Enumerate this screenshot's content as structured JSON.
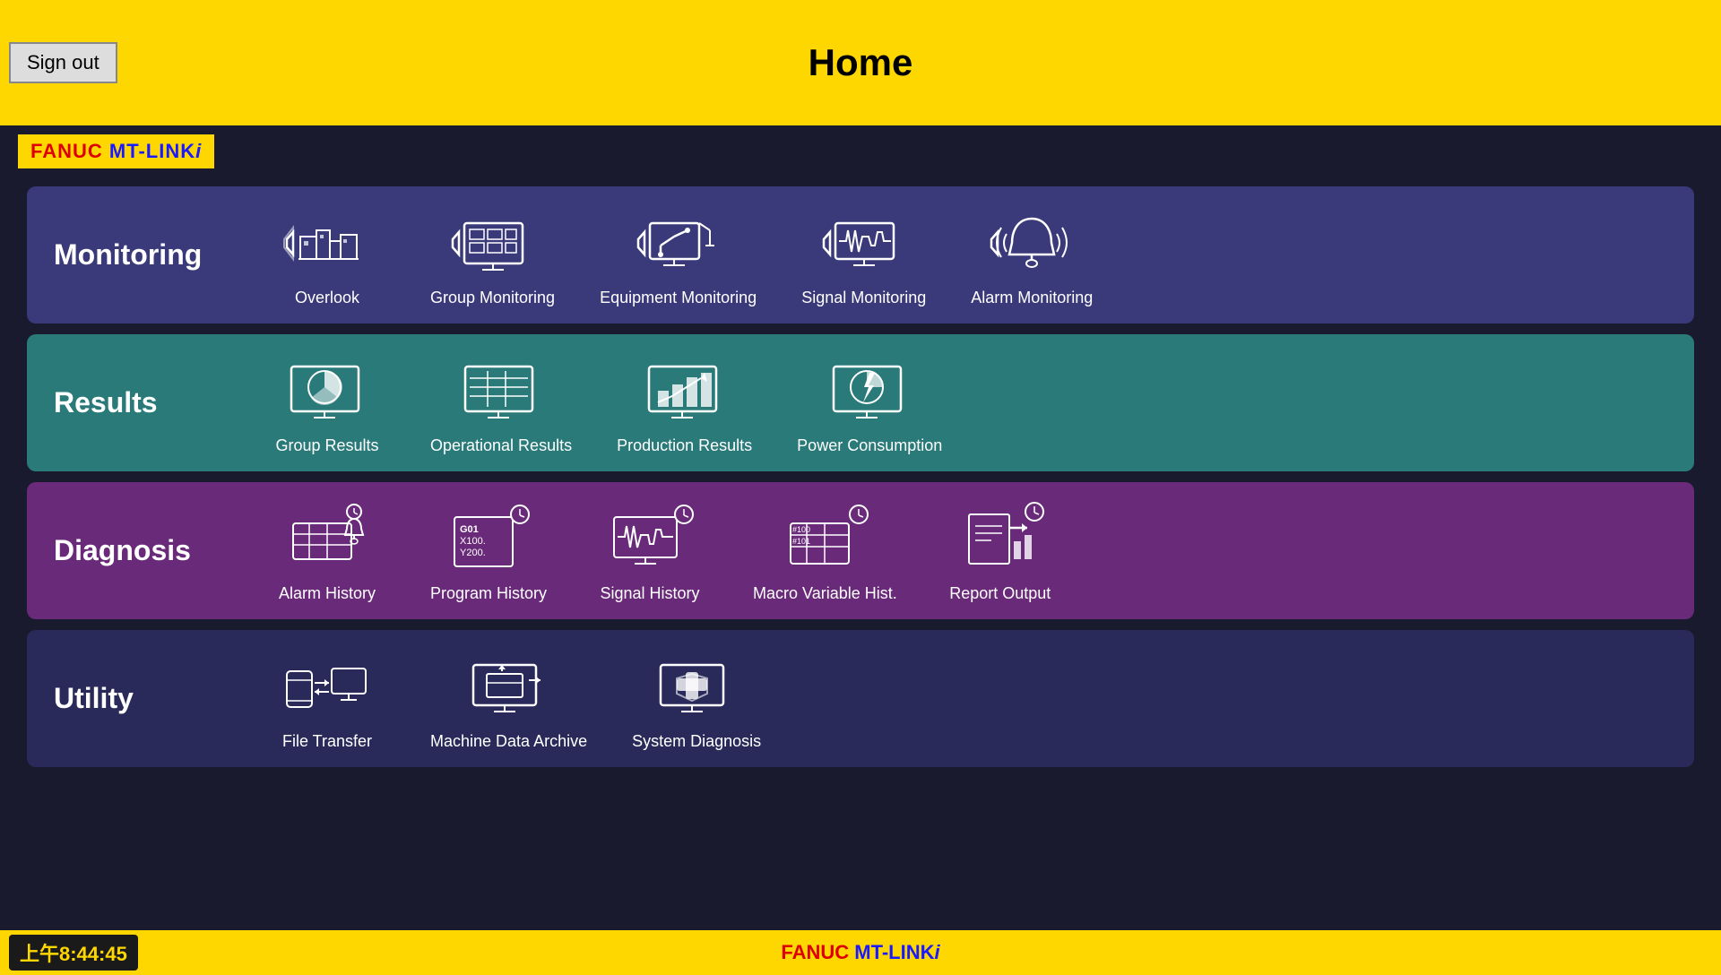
{
  "header": {
    "title": "Home",
    "sign_out_label": "Sign out"
  },
  "logo": {
    "text": "FANUC MT-LINKi"
  },
  "sections": [
    {
      "id": "monitoring",
      "label": "Monitoring",
      "items": [
        {
          "id": "overlook",
          "label": "Overlook"
        },
        {
          "id": "group-monitoring",
          "label": "Group Monitoring"
        },
        {
          "id": "equipment-monitoring",
          "label": "Equipment Monitoring"
        },
        {
          "id": "signal-monitoring",
          "label": "Signal Monitoring"
        },
        {
          "id": "alarm-monitoring",
          "label": "Alarm Monitoring"
        }
      ]
    },
    {
      "id": "results",
      "label": "Results",
      "items": [
        {
          "id": "group-results",
          "label": "Group Results"
        },
        {
          "id": "operational-results",
          "label": "Operational Results"
        },
        {
          "id": "production-results",
          "label": "Production Results"
        },
        {
          "id": "power-consumption",
          "label": "Power Consumption"
        }
      ]
    },
    {
      "id": "diagnosis",
      "label": "Diagnosis",
      "items": [
        {
          "id": "alarm-history",
          "label": "Alarm History"
        },
        {
          "id": "program-history",
          "label": "Program History"
        },
        {
          "id": "signal-history",
          "label": "Signal History"
        },
        {
          "id": "macro-variable",
          "label": "Macro Variable Hist."
        },
        {
          "id": "report-output",
          "label": "Report Output"
        }
      ]
    },
    {
      "id": "utility",
      "label": "Utility",
      "items": [
        {
          "id": "file-transfer",
          "label": "File Transfer"
        },
        {
          "id": "machine-data-archive",
          "label": "Machine Data Archive"
        },
        {
          "id": "system-diagnosis",
          "label": "System Diagnosis"
        }
      ]
    }
  ],
  "footer": {
    "time": "上午8:44:45",
    "logo": "FANUC MT-LINKi"
  }
}
